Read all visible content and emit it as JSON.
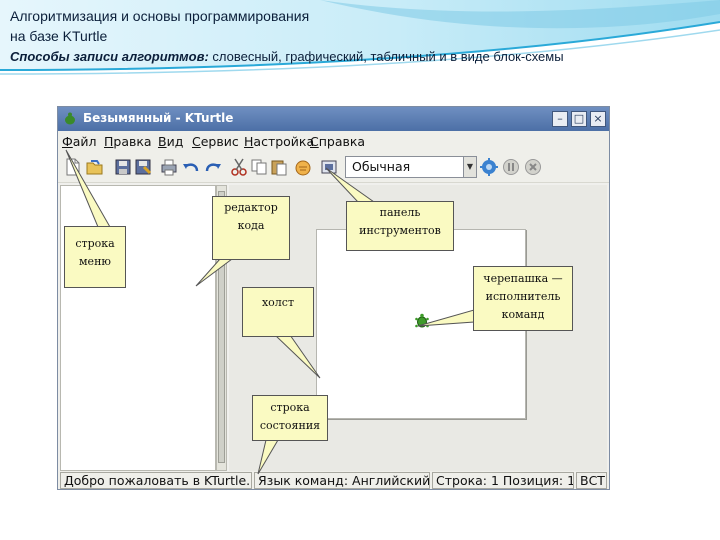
{
  "slide": {
    "title_line1": "Алгоритмизация и основы программирования",
    "title_line2": "на базе KTurtle",
    "subtitle_italic": "Способы записи алгоритмов:",
    "subtitle_rest": " словесный, графический, табличный и в виде блок-схемы"
  },
  "window": {
    "title": "Безымянный - KTurtle",
    "controls": {
      "minimize": "–",
      "maximize": "□",
      "close": "×"
    }
  },
  "menu": [
    {
      "first": "Ф",
      "rest": "айл"
    },
    {
      "first": "П",
      "rest": "равка"
    },
    {
      "first": "В",
      "rest": "ид"
    },
    {
      "first": "С",
      "rest": "ервис"
    },
    {
      "first": "Н",
      "rest": "астройка"
    },
    {
      "first": "С",
      "rest": "правка"
    }
  ],
  "toolbar": {
    "speed_selected": "Обычная",
    "icons": [
      "new-file-icon",
      "open-file-icon",
      "save-icon",
      "save-as-icon",
      "print-icon",
      "undo-icon",
      "redo-icon",
      "cut-icon",
      "copy-icon",
      "paste-icon",
      "hand-icon",
      "fullscreen-icon",
      "run-icon",
      "pause-icon",
      "stop-icon"
    ]
  },
  "status": {
    "welcome": "Добро пожаловать в KTurtle...",
    "language": "Язык команд: Английский",
    "position": "Строка: 1 Позиция: 1",
    "mode": "ВСТ"
  },
  "callouts": {
    "code_editor": [
      "редактор",
      "кода"
    ],
    "toolbar": [
      "панель",
      "инструментов"
    ],
    "menu_bar": [
      "строка",
      "меню"
    ],
    "canvas": [
      "холст"
    ],
    "turtle": [
      "черепашка —",
      "исполнитель",
      "команд"
    ],
    "status_bar": [
      "строка",
      "состояния"
    ]
  },
  "colors": {
    "callout_fill": "#fafac2",
    "titlebar": "#5a7db3",
    "header_swoosh": "#2aa9d8"
  }
}
